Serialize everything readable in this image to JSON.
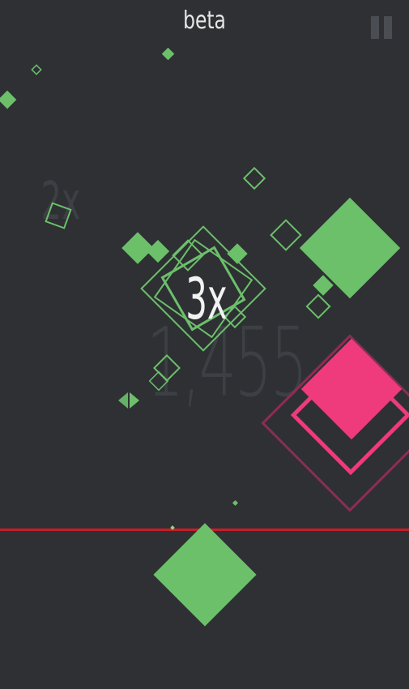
{
  "header": {
    "title": "beta",
    "pause_icon": "pause-icon"
  },
  "hud": {
    "score": "1,455",
    "current_multiplier": "3x",
    "previous_multiplier": "2x"
  },
  "colors": {
    "background": "#2e3034",
    "green": "#6cc06a",
    "pink": "#ef3a7c",
    "dark_pink": "#8a2e54",
    "deadline": "#c41e2a"
  }
}
